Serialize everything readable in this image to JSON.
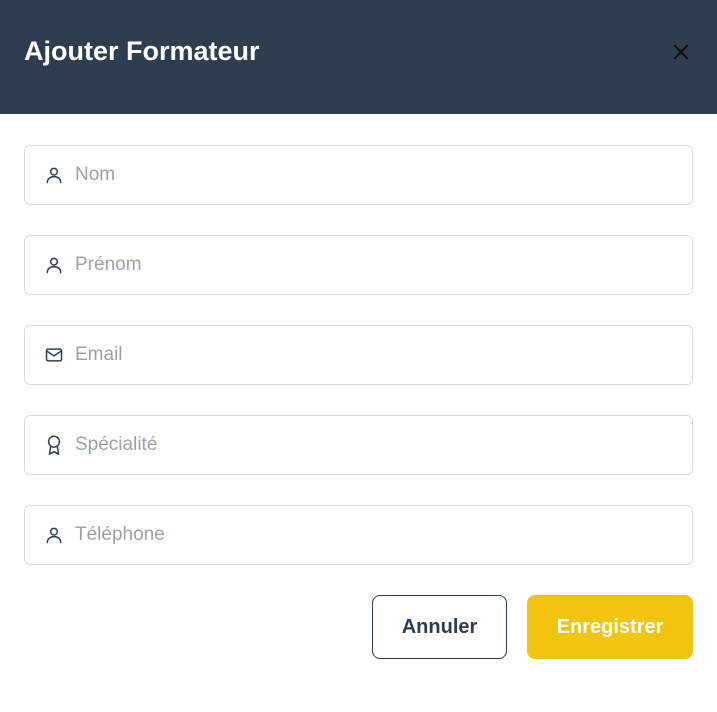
{
  "dialog": {
    "title": "Ajouter Formateur",
    "close_icon": "close-icon"
  },
  "form": {
    "fields": [
      {
        "name": "nom",
        "placeholder": "Nom",
        "value": "",
        "icon": "user-icon"
      },
      {
        "name": "prenom",
        "placeholder": "Prénom",
        "value": "",
        "icon": "user-icon"
      },
      {
        "name": "email",
        "placeholder": "Email",
        "value": "",
        "icon": "mail-icon"
      },
      {
        "name": "specialite",
        "placeholder": "Spécialité",
        "value": "",
        "icon": "award-icon"
      },
      {
        "name": "telephone",
        "placeholder": "Téléphone",
        "value": "",
        "icon": "user-icon"
      }
    ]
  },
  "actions": {
    "cancel_label": "Annuler",
    "save_label": "Enregistrer"
  },
  "colors": {
    "header_bg": "#2e3d50",
    "accent": "#f1c40f",
    "border": "#d9dde3",
    "placeholder": "#9aa1ab"
  }
}
